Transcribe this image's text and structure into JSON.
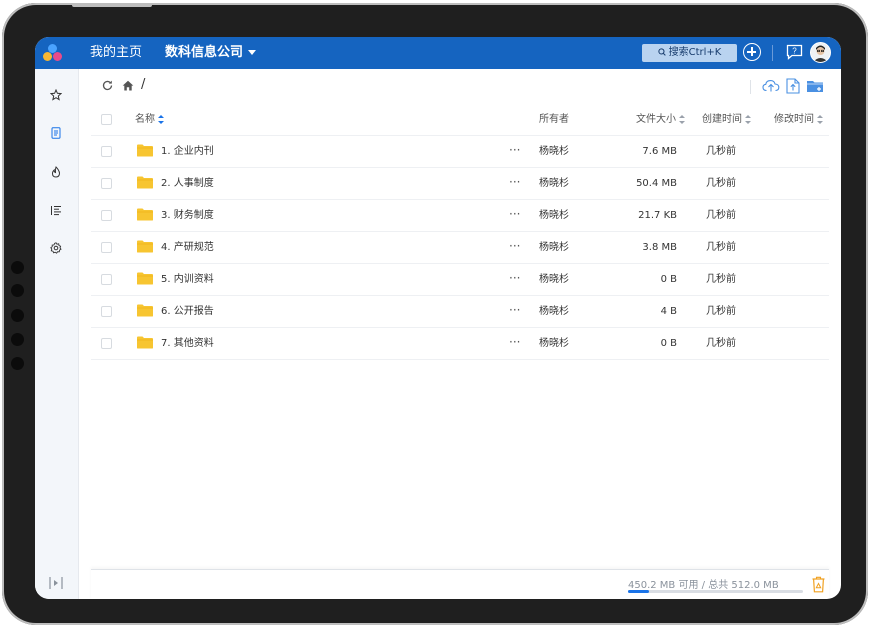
{
  "topbar": {
    "home_label": "我的主页",
    "org_label": "数科信息公司",
    "search_label": "搜索Ctrl+K",
    "icons": [
      "search-icon",
      "plus-icon",
      "help-icon",
      "avatar"
    ]
  },
  "sidebar": {
    "items": [
      {
        "name": "favorites",
        "icon": "star-icon"
      },
      {
        "name": "documents",
        "icon": "document-icon"
      },
      {
        "name": "recent",
        "icon": "fire-icon"
      },
      {
        "name": "list",
        "icon": "list-icon"
      },
      {
        "name": "settings",
        "icon": "gear-icon"
      }
    ],
    "collapse_icon": "collapse-icon"
  },
  "toolbar": {
    "path": "/",
    "icons": [
      "refresh-icon",
      "home-icon",
      "cloud-upload-icon",
      "file-upload-icon",
      "new-folder-icon"
    ]
  },
  "table": {
    "headers": {
      "name": "名称",
      "owner": "所有者",
      "size": "文件大小",
      "created": "创建时间",
      "modified": "修改时间"
    },
    "rows": [
      {
        "name": "1. 企业内刊",
        "more": "···",
        "owner": "杨晓杉",
        "size": "7.6 MB",
        "created": "几秒前"
      },
      {
        "name": "2. 人事制度",
        "more": "···",
        "owner": "杨晓杉",
        "size": "50.4 MB",
        "created": "几秒前"
      },
      {
        "name": "3. 财务制度",
        "more": "···",
        "owner": "杨晓杉",
        "size": "21.7 KB",
        "created": "几秒前"
      },
      {
        "name": "4. 产研规范",
        "more": "···",
        "owner": "杨晓杉",
        "size": "3.8 MB",
        "created": "几秒前"
      },
      {
        "name": "5. 内训资料",
        "more": "···",
        "owner": "杨晓杉",
        "size": "0 B",
        "created": "几秒前"
      },
      {
        "name": "6. 公开报告",
        "more": "···",
        "owner": "杨晓杉",
        "size": "4 B",
        "created": "几秒前"
      },
      {
        "name": "7. 其他资料",
        "more": "···",
        "owner": "杨晓杉",
        "size": "0 B",
        "created": "几秒前"
      }
    ]
  },
  "footer": {
    "storage_text": "450.2 MB 可用 / 总共 512.0 MB",
    "storage_used_fraction": 0.12,
    "trash_icon": "trash-icon"
  },
  "colors": {
    "topbar": "#1564c0",
    "accent": "#1a73e8",
    "folder": "#f7c531",
    "sidebar_bg": "#f3f6fa"
  }
}
